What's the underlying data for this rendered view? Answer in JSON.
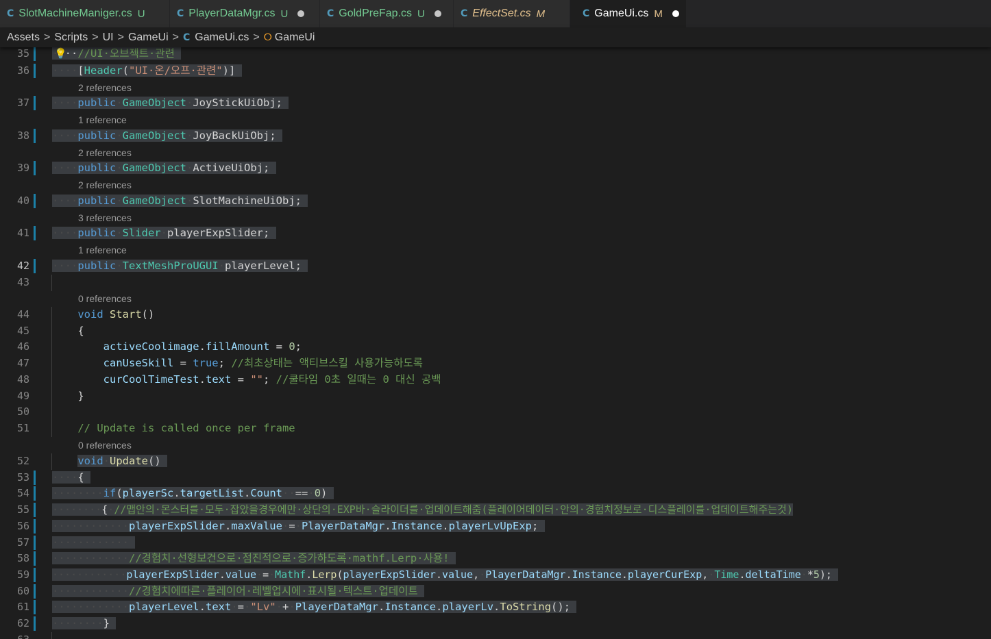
{
  "tabs": [
    {
      "name": "SlotMachineManiger.cs",
      "status": "U",
      "dirty": false,
      "active": false
    },
    {
      "name": "PlayerDataMgr.cs",
      "status": "U",
      "dirty": true,
      "active": false
    },
    {
      "name": "GoldPreFap.cs",
      "status": "U",
      "dirty": true,
      "active": false
    },
    {
      "name": "EffectSet.cs",
      "status": "M",
      "dirty": false,
      "active": false
    },
    {
      "name": "GameUi.cs",
      "status": "M",
      "dirty": true,
      "active": true
    }
  ],
  "breadcrumb": [
    "Assets",
    "Scripts",
    "UI",
    "GameUi",
    "GameUi.cs",
    "GameUi"
  ],
  "lines": [
    {
      "num": "35",
      "text": "//UI 오브젝트 관련"
    },
    {
      "num": "36",
      "text": "[Header(\"UI 온/오프 관련\")]"
    },
    {
      "lens": "2 references"
    },
    {
      "num": "37",
      "text": "public GameObject JoyStickUiObj;"
    },
    {
      "lens": "1 reference"
    },
    {
      "num": "38",
      "text": "public GameObject JoyBackUiObj;"
    },
    {
      "lens": "2 references"
    },
    {
      "num": "39",
      "text": "public GameObject ActiveUiObj;"
    },
    {
      "lens": "2 references"
    },
    {
      "num": "40",
      "text": "public GameObject SlotMachineUiObj;"
    },
    {
      "lens": "3 references"
    },
    {
      "num": "41",
      "text": "public Slider playerExpSlider;"
    },
    {
      "lens": "1 reference"
    },
    {
      "num": "42",
      "text": "public TextMeshProUGUI playerLevel;"
    },
    {
      "num": "43",
      "text": ""
    },
    {
      "lens": "0 references"
    },
    {
      "num": "44",
      "text": "void Start()"
    },
    {
      "num": "45",
      "text": "{"
    },
    {
      "num": "46",
      "text": "activeCoolimage.fillAmount = 0;"
    },
    {
      "num": "47",
      "text": "canUseSkill = true; //최초상태는 액티브스킬 사용가능하도록"
    },
    {
      "num": "48",
      "text": "curCoolTimeTest.text = \"\"; //쿨타임 0초 일때는 0 대신 공백"
    },
    {
      "num": "49",
      "text": "}"
    },
    {
      "num": "50",
      "text": ""
    },
    {
      "num": "51",
      "text": "// Update is called once per frame"
    },
    {
      "lens": "0 references"
    },
    {
      "num": "52",
      "text": "void Update()"
    },
    {
      "num": "53",
      "text": "{"
    },
    {
      "num": "54",
      "text": "if(playerSc.targetList.Count  == 0)"
    },
    {
      "num": "55",
      "text": "{ //맵안의 몬스터를 모두 잡았을경우에만 상단의 EXP바 슬라이더를 업데이트해줌(플레이어데이터 안의 경험치정보로 디스플레이를 업데이트해주는것)"
    },
    {
      "num": "56",
      "text": "playerExpSlider.maxValue = PlayerDataMgr.Instance.playerLvUpExp;"
    },
    {
      "num": "57",
      "text": ""
    },
    {
      "num": "58",
      "text": "//경험치 선형보건으로 점진적으로 증가하도록 mathf.Lerp 사용!"
    },
    {
      "num": "59",
      "text": "playerExpSlider.value = Mathf.Lerp(playerExpSlider.value, PlayerDataMgr.Instance.playerCurExp, Time.deltaTime *5);"
    },
    {
      "num": "60",
      "text": "//경험치에따른 플레이어 레벨업시에 표시될 텍스트 업데이트"
    },
    {
      "num": "61",
      "text": "playerLevel.text = \"Lv\" + PlayerDataMgr.Instance.playerLv.ToString();"
    },
    {
      "num": "62",
      "text": "}"
    },
    {
      "num": "63",
      "text": ""
    }
  ],
  "colors": {
    "keyword": "#569cd6",
    "type": "#4ec9b0",
    "identifier": "#9cdcfe",
    "function": "#dcdcaa",
    "string": "#ce9178",
    "number": "#b5cea8",
    "comment": "#6a9955",
    "selection": "#3a3d41",
    "modified_bar": "#1b81a8"
  }
}
